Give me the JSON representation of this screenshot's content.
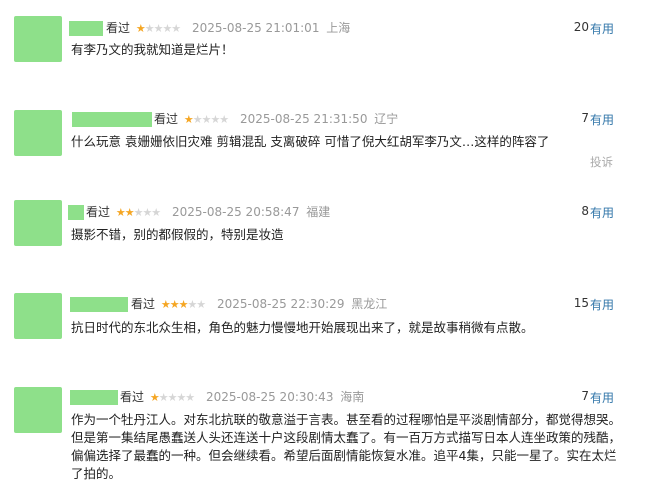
{
  "reviews": [
    {
      "watched_label": "看过",
      "rating": 1,
      "time": "2025-08-25 21:01:01",
      "location": "上海",
      "content": "有李乃文的我就知道是烂片！",
      "votes": "20",
      "useful_label": "有用",
      "report_label": ""
    },
    {
      "watched_label": "看过",
      "rating": 1,
      "time": "2025-08-25 21:31:50",
      "location": "辽宁",
      "content": "什么玩意 袁姗姗依旧灾难 剪辑混乱 支离破碎 可惜了倪大红胡军李乃文…这样的阵容了",
      "votes": "7",
      "useful_label": "有用",
      "report_label": "投诉"
    },
    {
      "watched_label": "看过",
      "rating": 2,
      "time": "2025-08-25 20:58:47",
      "location": "福建",
      "content": "摄影不错，别的都假假的，特别是妆造",
      "votes": "8",
      "useful_label": "有用",
      "report_label": ""
    },
    {
      "watched_label": "看过",
      "rating": 3,
      "time": "2025-08-25 22:30:29",
      "location": "黑龙江",
      "content": "抗日时代的东北众生相，角色的魅力慢慢地开始展现出来了，就是故事稍微有点散。",
      "votes": "15",
      "useful_label": "有用",
      "report_label": ""
    },
    {
      "watched_label": "看过",
      "rating": 1,
      "time": "2025-08-25 20:30:43",
      "location": "海南",
      "content": "作为一个牡丹江人。对东北抗联的敬意溢于言表。甚至看的过程哪怕是平淡剧情部分，都觉得想哭。但是第一集结尾愚蠢送人头还连送十户这段剧情太蠢了。有一百万方式描写日本人连坐政策的残酷，偏偏选择了最蠢的一种。但会继续看。希望后面剧情能恢复水准。追平4集，只能一星了。实在太烂了拍的。",
      "votes": "7",
      "useful_label": "有用",
      "report_label": ""
    }
  ]
}
